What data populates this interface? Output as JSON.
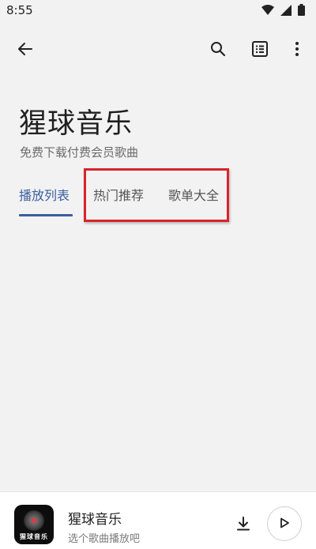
{
  "status_bar": {
    "time": "8:55",
    "icons": [
      "wifi-icon",
      "signal-icon",
      "battery-icon"
    ]
  },
  "app_bar": {
    "icons": [
      "back-arrow-icon",
      "search-icon",
      "list-view-icon",
      "more-vert-icon"
    ]
  },
  "header": {
    "title": "猩球音乐",
    "subtitle": "免费下载付费会员歌曲"
  },
  "tabs": [
    {
      "label": "播放列表",
      "active": true
    },
    {
      "label": "热门推荐",
      "active": false
    },
    {
      "label": "歌单大全",
      "active": false
    }
  ],
  "player": {
    "album_text": "猩球音乐",
    "title": "猩球音乐",
    "subtitle": "选个歌曲播放吧",
    "icons": [
      "download-icon",
      "play-icon"
    ]
  },
  "colors": {
    "accent": "#3a5f9e",
    "highlight": "#d9232a",
    "background": "#f2f2f2"
  }
}
